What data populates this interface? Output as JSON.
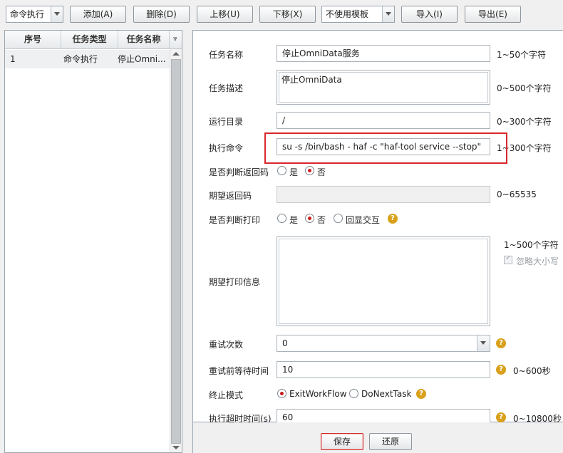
{
  "toolbar": {
    "task_type_selected": "命令执行",
    "add_label": "添加(A)",
    "delete_label": "删除(D)",
    "move_up_label": "上移(U)",
    "move_down_label": "下移(X)",
    "template_selected": "不使用模板",
    "import_label": "导入(I)",
    "export_label": "导出(E)"
  },
  "task_list": {
    "columns": [
      "序号",
      "任务类型",
      "任务名称"
    ],
    "rows": [
      {
        "index": "1",
        "type": "命令执行",
        "name": "停止Omni..."
      }
    ]
  },
  "form": {
    "task_name": {
      "label": "任务名称",
      "value": "停止OmniData服务",
      "hint": "1~50个字符"
    },
    "task_desc": {
      "label": "任务描述",
      "value": "停止OmniData",
      "hint": "0~500个字符"
    },
    "run_dir": {
      "label": "运行目录",
      "value": "/",
      "hint": "0~300个字符"
    },
    "command": {
      "label": "执行命令",
      "value": "su -s /bin/bash - haf -c \"haf-tool service --stop\"",
      "hint": "1~300个字符"
    },
    "check_return": {
      "label": "是否判断返回码",
      "opt_yes": "是",
      "opt_no": "否",
      "selected": "否"
    },
    "expected_return": {
      "label": "期望返回码",
      "value": "",
      "hint": "0~65535"
    },
    "check_print": {
      "label": "是否判断打印",
      "opt_yes": "是",
      "opt_no": "否",
      "opt_echo": "回显交互",
      "selected": "否"
    },
    "expected_print": {
      "label": "期望打印信息",
      "value": "",
      "hint": "1~500个字符",
      "ignore_case_label": "忽略大小写"
    },
    "retry_count": {
      "label": "重试次数",
      "value": "0"
    },
    "retry_wait": {
      "label": "重试前等待时间",
      "value": "10",
      "hint": "0~600秒"
    },
    "stop_mode": {
      "label": "终止模式",
      "opt_exit": "ExitWorkFlow",
      "opt_next": "DoNextTask",
      "selected": "ExitWorkFlow"
    },
    "timeout": {
      "label": "执行超时时间(s)",
      "value": "60",
      "hint": "0~10800秒"
    }
  },
  "footer": {
    "save_label": "保存",
    "restore_label": "还原"
  },
  "colors": {
    "accent_red": "#d9262b",
    "help_icon": "#d9a01a"
  }
}
